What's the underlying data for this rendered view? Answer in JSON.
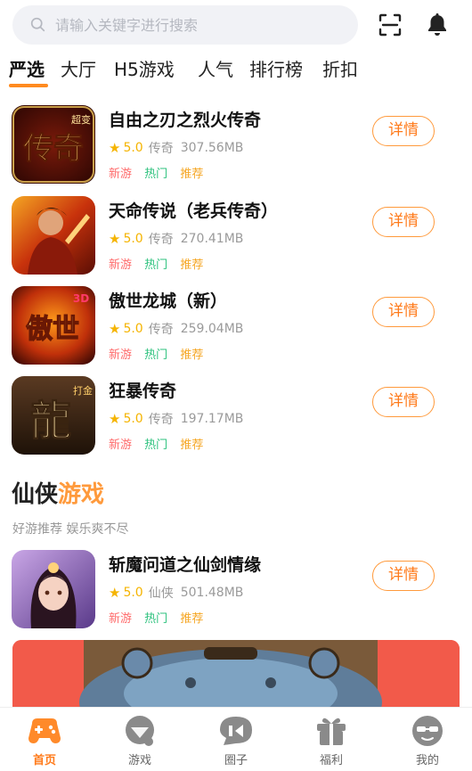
{
  "search": {
    "placeholder": "请输入关键字进行搜索"
  },
  "tabs": [
    "严选",
    "大厅",
    "H5游戏",
    "人气",
    "排行榜",
    "折扣"
  ],
  "games": [
    {
      "name": "自由之刃之烈火传奇",
      "rating": "5.0",
      "category": "传奇",
      "size": "307.56MB",
      "tags": [
        "新游",
        "热门",
        "推荐"
      ],
      "detail_label": "详情",
      "icon_text": "传奇",
      "icon_sub": "超变"
    },
    {
      "name": "天命传说（老兵传奇）",
      "rating": "5.0",
      "category": "传奇",
      "size": "270.41MB",
      "tags": [
        "新游",
        "热门",
        "推荐"
      ],
      "detail_label": "详情"
    },
    {
      "name": "傲世龙城（新）",
      "rating": "5.0",
      "category": "传奇",
      "size": "259.04MB",
      "tags": [
        "新游",
        "热门",
        "推荐"
      ],
      "detail_label": "详情",
      "icon_text": "傲世",
      "icon_sub": "3D"
    },
    {
      "name": "狂暴传奇",
      "rating": "5.0",
      "category": "传奇",
      "size": "197.17MB",
      "tags": [
        "新游",
        "热门",
        "推荐"
      ],
      "detail_label": "详情",
      "icon_text": "龍",
      "icon_sub": "打金"
    }
  ],
  "section": {
    "title_a": "仙侠",
    "title_b": "游戏",
    "subtitle": "好游推荐 娱乐爽不尽"
  },
  "section_games": [
    {
      "name": "斩魔问道之仙剑情缘",
      "rating": "5.0",
      "category": "仙侠",
      "size": "501.48MB",
      "tags": [
        "新游",
        "热门",
        "推荐"
      ],
      "detail_label": "详情"
    }
  ],
  "bottom_nav": [
    {
      "label": "首页",
      "icon": "gamepad-icon",
      "active": true
    },
    {
      "label": "游戏",
      "icon": "game-bubble-icon",
      "active": false
    },
    {
      "label": "圈子",
      "icon": "circle-icon",
      "active": false
    },
    {
      "label": "福利",
      "icon": "gift-icon",
      "active": false
    },
    {
      "label": "我的",
      "icon": "avatar-icon",
      "active": false
    }
  ],
  "colors": {
    "accent": "#ff7a1a",
    "star": "#f5b400",
    "tag_new": "#ff6b6b",
    "tag_hot": "#2ec27e",
    "tag_rec": "#f5a623"
  }
}
